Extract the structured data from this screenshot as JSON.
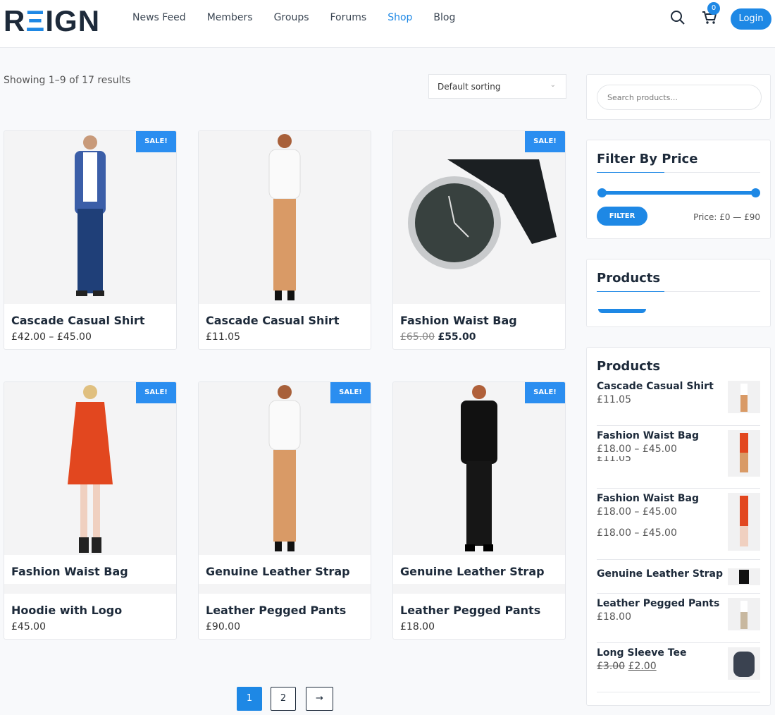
{
  "header": {
    "logo": "REIGN",
    "nav": [
      "News Feed",
      "Members",
      "Groups",
      "Forums",
      "Shop",
      "Blog"
    ],
    "active": "Shop",
    "cart_count": "0",
    "login_label": "Login",
    "accent": "#1e88e5"
  },
  "toolbar": {
    "result_count": "Showing 1–9 of 17 results",
    "sorting": "Default sorting"
  },
  "products": [
    {
      "title": "Cascade Casual Shirt",
      "price": "£42.00 – £45.00",
      "sale": "SALE!"
    },
    {
      "title": "Cascade Casual Shirt",
      "price": "£11.05"
    },
    {
      "title": "Fashion Waist Bag",
      "old_price": "£65.00",
      "price": "£55.00",
      "sale": "SALE!"
    },
    {
      "overlay_title": "Fashion Waist Bag",
      "title": "Hoodie with Logo",
      "price": "£45.00",
      "sale": "SALE!"
    },
    {
      "overlay_title": "Genuine Leather Strap",
      "title": "Leather Pegged Pants",
      "price": "£90.00",
      "sale": "SALE!"
    },
    {
      "overlay_title": "Genuine Leather Strap",
      "title": "Leather Pegged Pants",
      "price": "£18.00",
      "sale": "SALE!"
    }
  ],
  "pagination": {
    "pages": [
      "1",
      "2"
    ],
    "current": "1",
    "next": "→"
  },
  "sidebar": {
    "search_placeholder": "Search products...",
    "filter": {
      "title": "Filter By Price",
      "button": "FILTER",
      "range": "Price: £0 — £90",
      "min": 0,
      "max": 90
    },
    "products_widget_title": "Products",
    "products_list_title": "Products",
    "products_list": [
      {
        "title": "Cascade Casual Shirt",
        "price": "£11.05"
      },
      {
        "title": "Fashion Waist Bag",
        "price": "£18.00 – £45.00",
        "ghost": "£11.05"
      },
      {
        "title": "Fashion Waist Bag",
        "price": "£18.00 – £45.00",
        "extra": "£18.00 – £45.00"
      },
      {
        "title": "Genuine Leather Strap",
        "price": ""
      },
      {
        "title": "Leather Pegged Pants",
        "price": "£18.00"
      },
      {
        "title": "Long Sleeve Tee",
        "old_price": "£3.00",
        "price": "£2.00"
      }
    ]
  }
}
